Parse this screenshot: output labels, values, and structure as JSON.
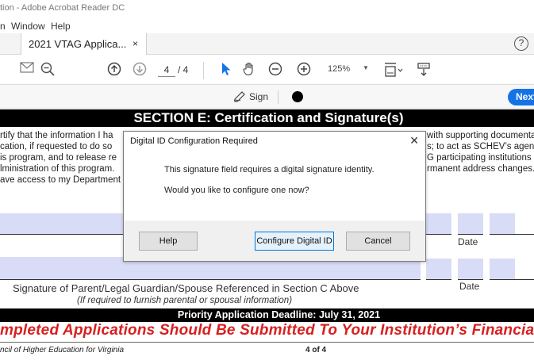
{
  "window": {
    "title": "tion - Adobe Acrobat Reader DC"
  },
  "menu": {
    "items": [
      "n",
      "Window",
      "Help"
    ]
  },
  "tabs": {
    "active_label": "2021 VTAG Applica...",
    "close": "×"
  },
  "help_button": {
    "label": "?"
  },
  "toolbar": {
    "page_current": "4",
    "page_total": "/ 4",
    "zoom": "125%",
    "icons": [
      "mail-icon",
      "zoom-out-magnifier-icon",
      "page-up-icon",
      "page-down-icon",
      "select-cursor-icon",
      "hand-icon",
      "zoom-minus-icon",
      "zoom-plus-icon",
      "page-display-icon",
      "tools-icon"
    ]
  },
  "signbar": {
    "sign_label": "Sign",
    "next_label": "Next"
  },
  "document": {
    "section_title": "SECTION E: Certification and Signature(s)",
    "left_lines": [
      "rtify that the information I ha",
      "cation, if requested to do so",
      "is program, and to release re",
      "lministration of this program.",
      "ave access to my Department"
    ],
    "right_lines": [
      "with supporting documenta",
      "s; to act as SCHEV’s agent",
      "G participating institutions e",
      "rmanent address changes."
    ],
    "date_label_1": "Date",
    "date_label_2": "Date",
    "signature_label": "Signature of Parent/Legal Guardian/Spouse Referenced in Section C Above",
    "signature_sub": "(If required to furnish parental or spousal information)",
    "deadline": "Priority Application Deadline: July 31, 2021",
    "banner": "mpleted Applications Should Be Submitted To Your Institution’s Financial",
    "footer_left": "ncil of Higher Education for Virginia",
    "footer_page": "4 of 4"
  },
  "dialog": {
    "title": "Digital ID Configuration Required",
    "close": "✕",
    "message_1": "This signature field requires a digital signature identity.",
    "message_2": "Would you like to configure one now?",
    "help_label": "Help",
    "configure_label": "Configure Digital ID",
    "cancel_label": "Cancel"
  },
  "colors": {
    "accent": "#1473e6",
    "field": "#d9dcf6",
    "banner_red": "#d91f1f"
  }
}
